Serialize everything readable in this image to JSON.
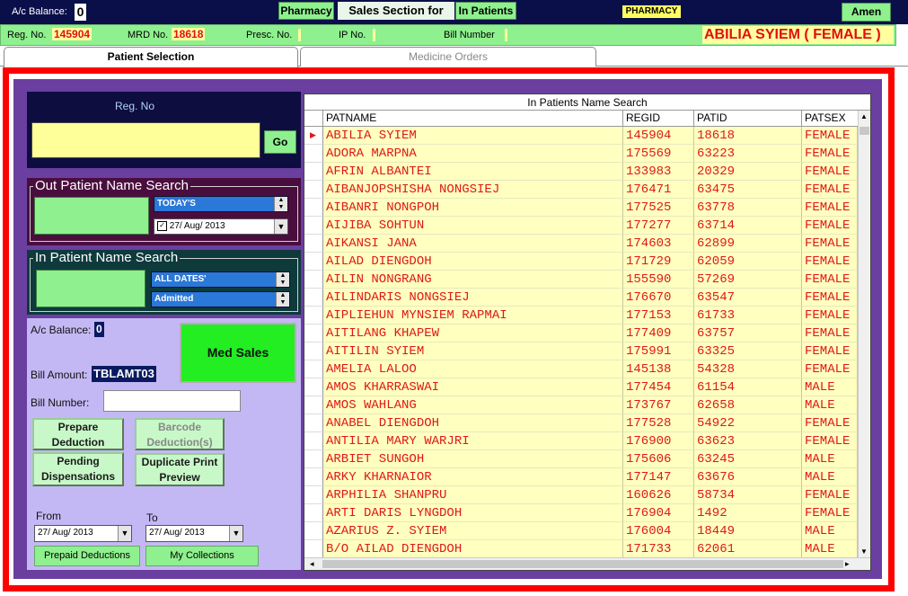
{
  "topbar": {
    "ac_balance_label": "A/c Balance:",
    "ac_balance_value": "0",
    "pharmacy_btn": "Pharmacy",
    "sales_section_label": "Sales Section for",
    "in_patients_btn": "In Patients",
    "pharmacy_badge": "PHARMACY",
    "user_btn": "Amen"
  },
  "infobar": {
    "reg_label": "Reg. No.",
    "reg_value": "145904",
    "mrd_label": "MRD No.",
    "mrd_value": "18618",
    "presc_label": "Presc. No.",
    "ip_label": "IP No.",
    "bill_label": "Bill Number",
    "patient_name": "ABILIA SYIEM ( FEMALE )"
  },
  "tabs": [
    {
      "label": "Patient Selection"
    },
    {
      "label": "Medicine Orders"
    }
  ],
  "regno_panel": {
    "title": "Reg. No",
    "input_value": "",
    "go_btn": "Go"
  },
  "out_patient": {
    "legend": "Out Patient Name Search",
    "filter": "TODAY'S",
    "date": "27/ Aug/ 2013"
  },
  "in_patient": {
    "legend": "In Patient Name Search",
    "filter": "ALL DATES'",
    "status": "Admitted"
  },
  "billing": {
    "ac_balance_label": "A/c Balance:",
    "ac_balance_value": "0",
    "med_sales_btn": "Med Sales",
    "bill_amount_label": "Bill Amount:",
    "bill_amount_value": "TBLAMT03",
    "bill_number_label": "Bill Number:",
    "bill_number_value": "",
    "prepare_btn": "Prepare Deduction",
    "barcode_btn": "Barcode Deduction(s)",
    "pending_btn": "Pending Dispensations",
    "duplicate_btn": "Duplicate Print Preview",
    "from_label": "From",
    "to_label": "To",
    "from_date": "27/ Aug/ 2013",
    "to_date": "27/ Aug/ 2013",
    "prepaid_btn": "Prepaid Deductions",
    "collections_btn": "My Collections"
  },
  "grid": {
    "caption": "In Patients Name Search",
    "columns": [
      "PATNAME",
      "REGID",
      "PATID",
      "PATSEX"
    ],
    "rows": [
      [
        "ABILIA SYIEM",
        "145904",
        "18618",
        "FEMALE"
      ],
      [
        "ADORA MARPNA",
        "175569",
        "63223",
        "FEMALE"
      ],
      [
        "AFRIN ALBANTEI",
        "133983",
        "20329",
        "FEMALE"
      ],
      [
        "AIBANJOPSHISHA NONGSIEJ",
        "176471",
        "63475",
        "FEMALE"
      ],
      [
        "AIBANRI NONGPOH",
        "177525",
        "63778",
        "FEMALE"
      ],
      [
        "AIJIBA SOHTUN",
        "177277",
        "63714",
        "FEMALE"
      ],
      [
        "AIKANSI JANA",
        "174603",
        "62899",
        "FEMALE"
      ],
      [
        "AILAD DIENGDOH",
        "171729",
        "62059",
        "FEMALE"
      ],
      [
        "AILIN NONGRANG",
        "155590",
        "57269",
        "FEMALE"
      ],
      [
        "AILINDARIS NONGSIEJ",
        "176670",
        "63547",
        "FEMALE"
      ],
      [
        "AIPLIEHUN MYNSIEM RAPMAI",
        "177153",
        "61733",
        "FEMALE"
      ],
      [
        "AITILANG KHAPEW",
        "177409",
        "63757",
        "FEMALE"
      ],
      [
        "AITILIN SYIEM",
        "175991",
        "63325",
        "FEMALE"
      ],
      [
        "AMELIA LALOO",
        "145138",
        "54328",
        "FEMALE"
      ],
      [
        "AMOS KHARRASWAI",
        "177454",
        "61154",
        "MALE"
      ],
      [
        "AMOS WAHLANG",
        "173767",
        "62658",
        "MALE"
      ],
      [
        "ANABEL DIENGDOH",
        "177528",
        "54922",
        "FEMALE"
      ],
      [
        "ANTILIA MARY WARJRI",
        "176900",
        "63623",
        "FEMALE"
      ],
      [
        "ARBIET SUNGOH",
        "175606",
        "63245",
        "MALE"
      ],
      [
        "ARKY KHARNAIOR",
        "177147",
        "63676",
        "MALE"
      ],
      [
        "ARPHILIA SHANPRU",
        "160626",
        "58734",
        "FEMALE"
      ],
      [
        "ARTI DARIS LYNGDOH",
        "176904",
        "1492",
        "FEMALE"
      ],
      [
        "AZARIUS Z. SYIEM",
        "176004",
        "18449",
        "MALE"
      ],
      [
        "B/O AILAD DIENGDOH",
        "171733",
        "62061",
        "MALE"
      ]
    ]
  },
  "colors": {
    "dark_navy": "#0a0f4a",
    "green": "#8ef08e",
    "red_frame": "#ff0000",
    "purple_frame": "#6a3fa0",
    "row_yellow": "#ffffc0",
    "row_text": "#e01818"
  }
}
